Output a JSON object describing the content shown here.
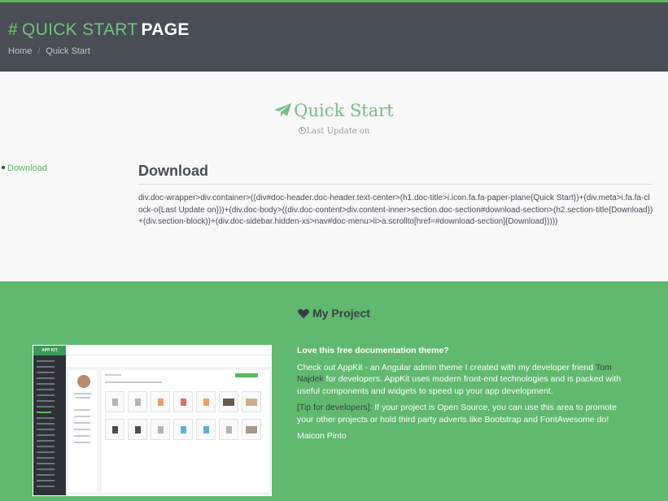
{
  "header": {
    "title_light": "QUICK START",
    "title_bold": "PAGE",
    "breadcrumb": {
      "home": "Home",
      "separator": "/",
      "current": "Quick Start"
    }
  },
  "doc": {
    "title": "Quick Start",
    "icon": "paper-plane-icon",
    "meta": "Last Update on"
  },
  "side_menu": {
    "items": [
      {
        "label": "Download"
      }
    ]
  },
  "section": {
    "title": "Download",
    "body": "div.doc-wrapper>div.container>((div#doc-header.doc-header.text-center>(h1.doc-title>i.icon.fa.fa-paper-plane{Quick Start})+(div.meta>i.fa.fa-clock-o{Last Update on}))+(div.doc-body>((div.doc-content>div.content-inner>section.doc-section#download-section>(h2.section-title{Download})+(div.section-block))+(div.doc-sidebar.hidden-xs>nav#doc-menu>li>a.scrollto[href=#download-section]{Download}))))"
  },
  "promo": {
    "title": "My Project",
    "icon": "heart-icon",
    "screenshot_logo": "APP KIT",
    "lead": "Love this free documentation theme?",
    "para1_before": "Check out AppKit - an Angular admin theme I created with my developer friend ",
    "para1_link": "Tom Najdek",
    "para1_after": " for developers. AppKit uses modern front-end technologies and is packed with useful components and widgets to speed up your app development.",
    "tip_label": "[Tip for developers]:",
    "tip_text": " If your project is Open Source, you can use this area to promote your other projects or hold third party adverts like Bootstrap and FontAwesome do!",
    "author": "Maicon Pinto"
  },
  "colors": {
    "header_bg": "#494d55",
    "accent_green": "#75c181",
    "promo_bg": "#60b96e",
    "link_green": "#5cb85c"
  }
}
